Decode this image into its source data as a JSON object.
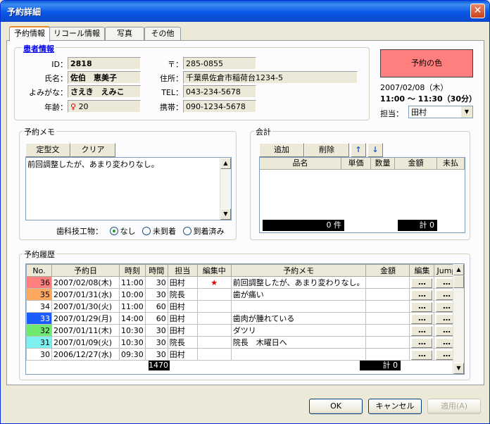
{
  "window": {
    "title": "予約詳細",
    "close": "✕"
  },
  "tabs": [
    "予約情報",
    "リコール情報",
    "写真",
    "その他"
  ],
  "patient": {
    "legend": "患者情報",
    "id_label": "ID：",
    "id": "2818",
    "name_label": "氏名：",
    "name": "佐伯　恵美子",
    "kana_label": "よみがな：",
    "kana": "さえき　えみこ",
    "age_label": "年齢：",
    "age": "20",
    "zip_label": "〒：",
    "zip": "285-0855",
    "addr_label": "住所：",
    "addr": "千葉県佐倉市稲荷台1234-5",
    "tel_label": "TEL：",
    "tel": "043-234-5678",
    "mobile_label": "携帯：",
    "mobile": "090-1234-5678"
  },
  "appointment": {
    "color_button": "予約の色",
    "color": "#ff7f7f",
    "date": "2007/02/08（木）",
    "time": "11:00 〜 11:30（30分）",
    "staff_label": "担当：",
    "staff": "田村"
  },
  "memo": {
    "legend": "予約メモ",
    "template_btn": "定型文",
    "clear_btn": "クリア",
    "text": "前回調整したが、あまり変わりなし。",
    "tech_label": "歯科技工物：",
    "opt_none": "なし",
    "opt_notyet": "未到着",
    "opt_arrived": "到着済み",
    "selected": "なし"
  },
  "account": {
    "legend": "会計",
    "add_btn": "追加",
    "del_btn": "削除",
    "cols": [
      "品名",
      "単価",
      "数量",
      "金額",
      "未払"
    ],
    "count": "0 件",
    "total": "計 0"
  },
  "history": {
    "legend": "予約履歴",
    "cols": [
      "No.",
      "予約日",
      "時刻",
      "時間",
      "担当",
      "編集中",
      "予約メモ",
      "金額",
      "編集",
      "Jump"
    ],
    "rows": [
      {
        "no": "36",
        "date": "2007/02/08(木)",
        "time": "11:00",
        "dur": "30",
        "staff": "田村",
        "editing": "★",
        "memo": "前回調整したが、あまり変わりなし。",
        "amount": "",
        "color": "#ff7f7f",
        "edit": "…",
        "jump": "…"
      },
      {
        "no": "35",
        "date": "2007/01/31(水)",
        "time": "10:00",
        "dur": "30",
        "staff": "院長",
        "editing": "",
        "memo": "歯が痛い",
        "amount": "",
        "color": "#ffa860",
        "edit": "…",
        "jump": "…"
      },
      {
        "no": "34",
        "date": "2007/01/30(火)",
        "time": "11:00",
        "dur": "60",
        "staff": "田村",
        "editing": "",
        "memo": "",
        "amount": "",
        "color": "#ffffff",
        "edit": "…",
        "jump": "…"
      },
      {
        "no": "33",
        "date": "2007/01/29(月)",
        "time": "14:00",
        "dur": "60",
        "staff": "田村",
        "editing": "",
        "memo": "歯肉が腫れている",
        "amount": "",
        "color": "#1a5cff",
        "edit": "…",
        "jump": "…"
      },
      {
        "no": "32",
        "date": "2007/01/11(木)",
        "time": "10:30",
        "dur": "30",
        "staff": "田村",
        "editing": "",
        "memo": "ダツリ",
        "amount": "",
        "color": "#6ee86e",
        "edit": "…",
        "jump": "…"
      },
      {
        "no": "31",
        "date": "2007/01/09(火)",
        "time": "10:30",
        "dur": "30",
        "staff": "院長",
        "editing": "",
        "memo": "院長　木曜日へ",
        "amount": "",
        "color": "#7ef0f0",
        "edit": "…",
        "jump": "…"
      },
      {
        "no": "30",
        "date": "2006/12/27(水)",
        "time": "09:30",
        "dur": "30",
        "staff": "田村",
        "editing": "",
        "memo": "",
        "amount": "",
        "color": "#ffffff",
        "edit": "…",
        "jump": "…"
      }
    ],
    "count": "1470",
    "total": "計 0"
  },
  "footer": {
    "ok": "OK",
    "cancel": "キャンセル",
    "apply": "適用(A)"
  }
}
